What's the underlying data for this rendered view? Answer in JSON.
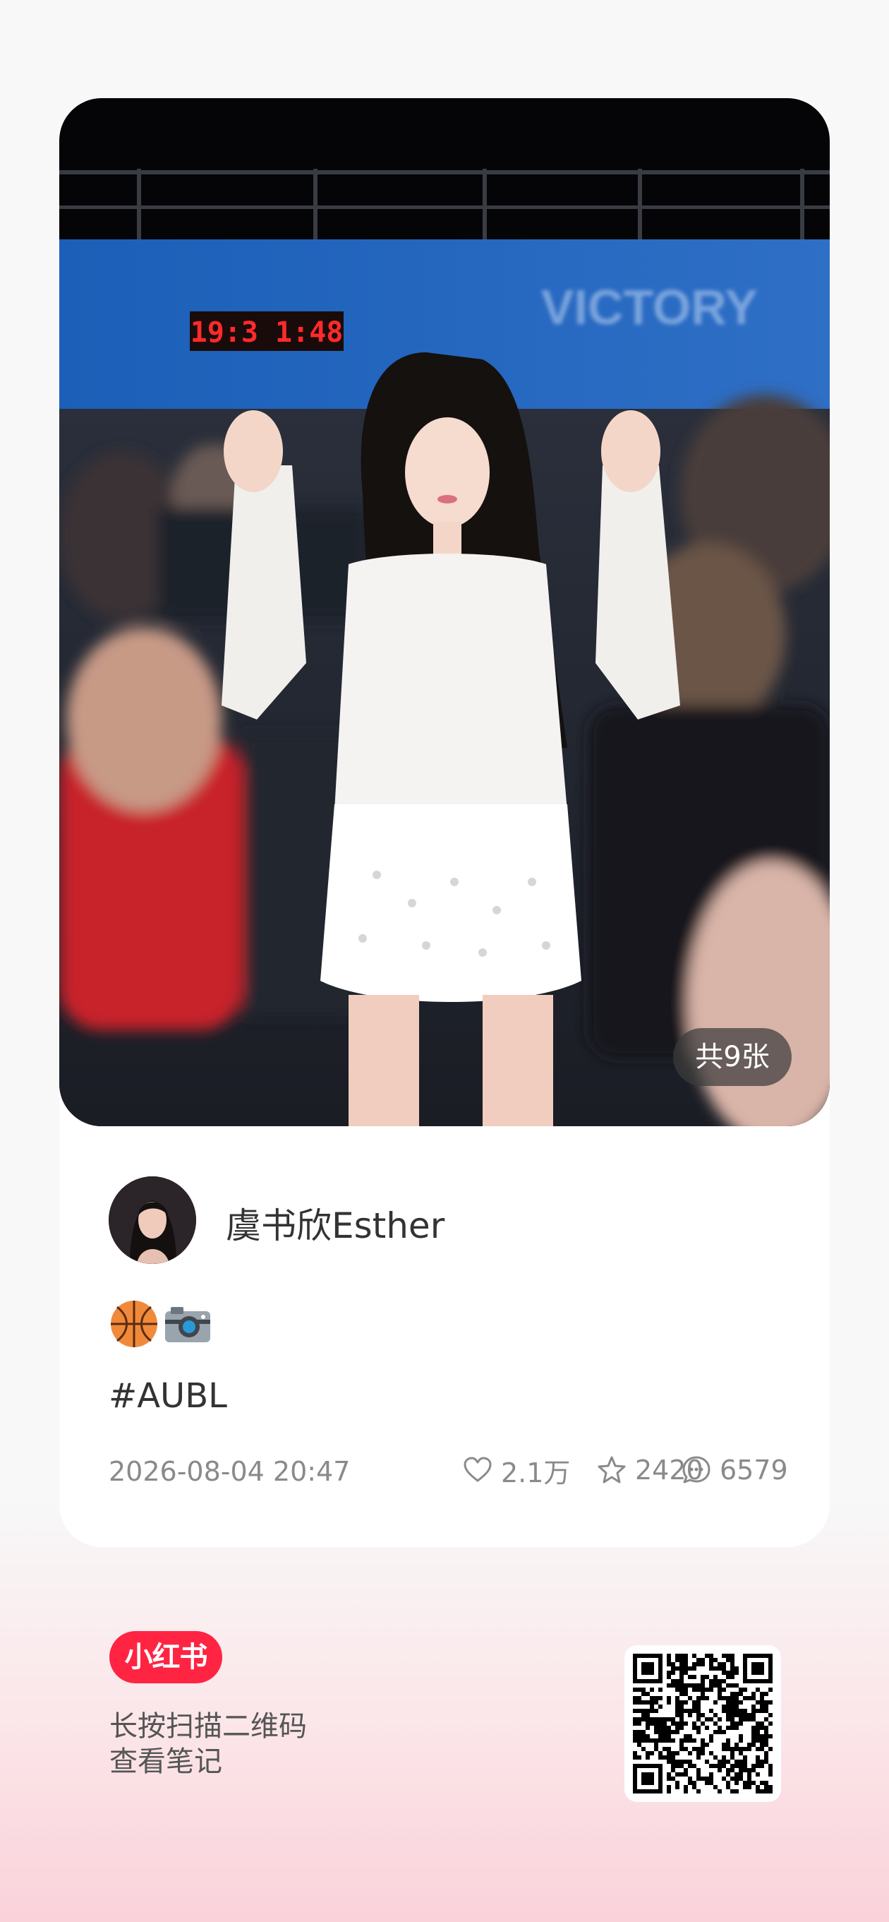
{
  "note": {
    "image_count_label": "共9张",
    "photo_scoreboard_text": "19:3 1:48",
    "photo_banner_text": "VICTORY",
    "author": {
      "name": "虞书欣Esther"
    },
    "emojis": [
      "basketball-icon",
      "camera-icon"
    ],
    "hashtag": "#AUBL",
    "date": "2026-08-04 20:47",
    "likes": "2.1万",
    "collects": "2420",
    "comments": "6579"
  },
  "footer": {
    "brand": "小红书",
    "scan_line1": "长按扫描二维码",
    "scan_line2": "查看笔记"
  },
  "colors": {
    "brand_red": "#ff2442",
    "text_primary": "#333333",
    "text_secondary": "#8a8a8a"
  }
}
